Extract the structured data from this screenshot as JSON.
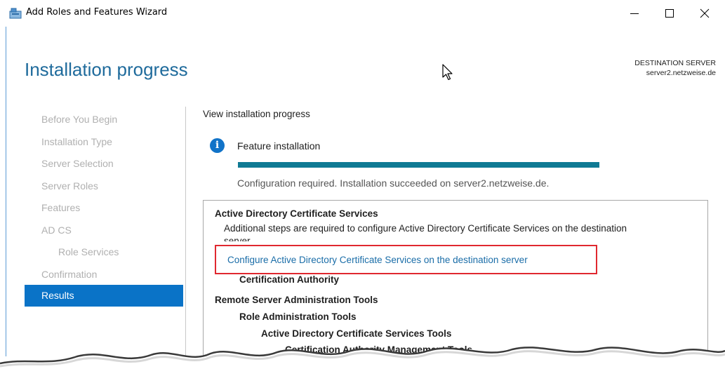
{
  "window": {
    "title": "Add Roles and Features Wizard",
    "accent": "#1f6b9c",
    "controls": {
      "minimize": "—",
      "maximize": "□",
      "close": "✕"
    }
  },
  "header": {
    "page_title": "Installation progress",
    "destination_label": "DESTINATION SERVER",
    "destination_server": "server2.netzweise.de"
  },
  "nav": {
    "items": [
      {
        "label": "Before You Begin",
        "state": "disabled"
      },
      {
        "label": "Installation Type",
        "state": "disabled"
      },
      {
        "label": "Server Selection",
        "state": "disabled"
      },
      {
        "label": "Server Roles",
        "state": "disabled"
      },
      {
        "label": "Features",
        "state": "disabled"
      },
      {
        "label": "AD CS",
        "state": "disabled"
      },
      {
        "label": "Role Services",
        "state": "disabled"
      },
      {
        "label": "Confirmation",
        "state": "disabled"
      },
      {
        "label": "Results",
        "state": "active"
      }
    ],
    "active_color": "#0a73c7"
  },
  "main": {
    "section_title": "View installation progress",
    "feature": {
      "icon": "info-icon",
      "title": "Feature installation",
      "progress": 1.0,
      "progress_color": "#0f7a94",
      "status": "Configuration required. Installation succeeded on server2.netzweise.de."
    },
    "results": {
      "adcs_heading": "Active Directory Certificate Services",
      "adcs_note": "Additional steps are required to configure Active Directory Certificate Services on the destination",
      "adcs_note_cont": "server.",
      "configure_link": "Configure Active Directory Certificate Services on the destination server",
      "cert_authority": "Certification Authority",
      "rsat_heading": "Remote Server Administration Tools",
      "role_admin_tools": "Role Administration Tools",
      "adcs_tools": "Active Directory Certificate Services Tools",
      "ca_mgmt_tools": "Certification Authority Management Tools"
    },
    "highlight_color": "#e0282f"
  }
}
